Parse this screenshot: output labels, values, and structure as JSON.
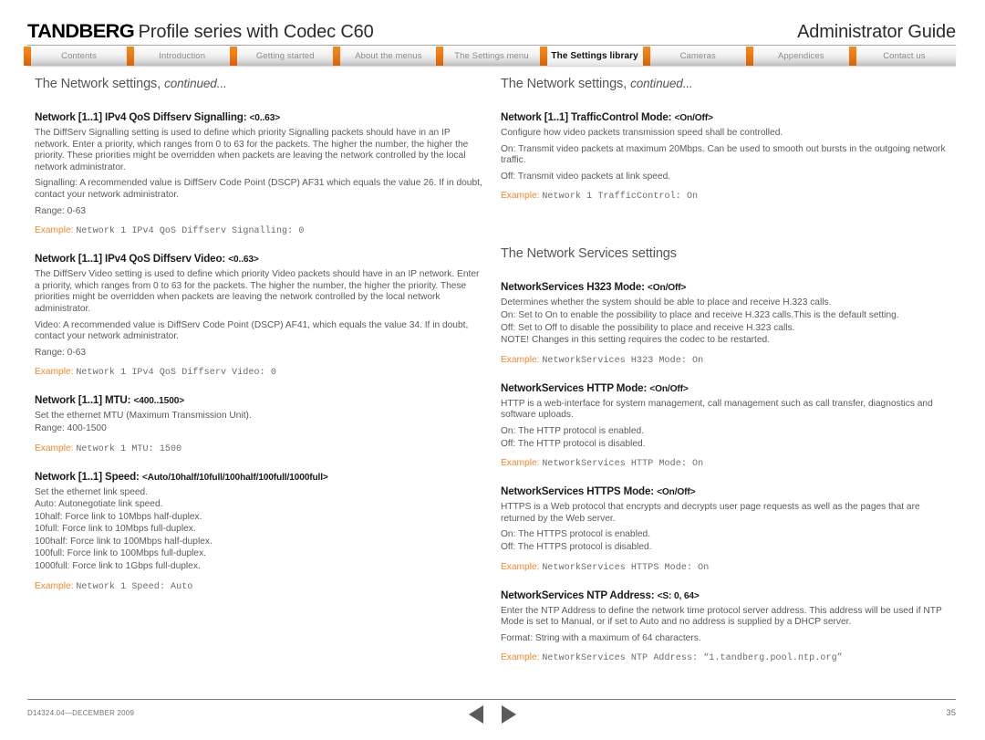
{
  "header": {
    "brand": "TANDBERG",
    "product": "Profile series with Codec C60",
    "guide_title": "Administrator Guide",
    "accent_color": "#ee7a10"
  },
  "tabs": [
    {
      "label": "Contents",
      "active": false
    },
    {
      "label": "Introduction",
      "active": false
    },
    {
      "label": "Getting started",
      "active": false
    },
    {
      "label": "About the menus",
      "active": false
    },
    {
      "label": "The Settings menu",
      "active": false
    },
    {
      "label": "The Settings library",
      "active": true
    },
    {
      "label": "Cameras",
      "active": false
    },
    {
      "label": "Appendices",
      "active": false
    },
    {
      "label": "Contact us",
      "active": false
    }
  ],
  "left_column": {
    "section_title": "The Network settings,",
    "section_title_italic": "continued...",
    "entries": [
      {
        "title": "Network [1..1] IPv4 QoS Diffserv Signalling:",
        "range": "<0..63>",
        "paragraphs": [
          "The DiffServ Signalling setting is used to define which priority Signalling packets should have in an IP network. Enter a priority, which ranges from 0 to 63 for the packets. The higher the number, the higher the priority. These priorities might be overridden when packets are leaving the network controlled by the local network administrator.",
          "Signalling: A recommended value is DiffServ Code Point (DSCP) AF31 which equals the value 26. If in doubt, contact your network administrator.",
          "Range: 0-63"
        ],
        "example_label": "Example:",
        "example_code": "Network 1 IPv4 QoS Diffserv Signalling: 0"
      },
      {
        "title": "Network [1..1] IPv4 QoS Diffserv Video:",
        "range": "<0..63>",
        "paragraphs": [
          "The DiffServ Video setting is used to define which priority Video packets should have in an IP network. Enter a priority, which ranges from 0 to 63 for the packets. The higher the number, the higher the priority. These priorities might be overridden when packets are leaving the network controlled by the local network administrator.",
          "Video: A recommended value is DiffServ Code Point (DSCP) AF41, which equals the value 34. If in doubt, contact your network administrator.",
          "Range: 0-63"
        ],
        "example_label": "Example:",
        "example_code": "Network 1 IPv4 QoS Diffserv Video: 0"
      },
      {
        "title": "Network [1..1] MTU:",
        "range": "<400..1500>",
        "paragraphs": [
          "Set the ethernet MTU (Maximum Transmission Unit).",
          "Range: 400-1500"
        ],
        "example_label": "Example:",
        "example_code": "Network 1 MTU: 1500"
      },
      {
        "title": "Network [1..1] Speed:",
        "range": "<Auto/10half/10full/100half/100full/1000full>",
        "paragraphs": [
          "Set the ethernet link speed.",
          "Auto: Autonegotiate link speed.",
          "10half: Force link to 10Mbps half-duplex.",
          "10full: Force link to 10Mbps full-duplex.",
          "100half: Force link to 100Mbps half-duplex.",
          "100full: Force link to 100Mbps full-duplex.",
          "1000full: Force link to 1Gbps full-duplex."
        ],
        "example_label": "Example:",
        "example_code": "Network 1 Speed: Auto"
      }
    ]
  },
  "right_column": {
    "section_title": "The Network settings,",
    "section_title_italic": "continued...",
    "section_title_2": "The Network Services settings",
    "entries_top": [
      {
        "title": "Network [1..1] TrafficControl Mode:",
        "range": "<On/Off>",
        "paragraphs": [
          "Configure how video packets transmission speed shall be controlled.",
          "On: Transmit video packets at maximum 20Mbps. Can be used to smooth out bursts in the outgoing network traffic.",
          "Off: Transmit video packets at link speed."
        ],
        "example_label": "Example:",
        "example_code": "Network 1 TrafficControl: On"
      }
    ],
    "entries_services": [
      {
        "title": "NetworkServices H323 Mode:",
        "range": "<On/Off>",
        "paragraphs": [
          "Determines whether the system should be able to place and receive H.323 calls.",
          "On: Set to On to enable the possibility to place and receive H.323 calls.This is the default setting.",
          "Off: Set to Off to disable the possibility to place and receive H.323 calls.",
          "NOTE! Changes in this setting requires the codec to be restarted."
        ],
        "example_label": "Example:",
        "example_code": "NetworkServices H323 Mode: On"
      },
      {
        "title": "NetworkServices HTTP Mode:",
        "range": "<On/Off>",
        "paragraphs": [
          "HTTP is a web-interface for system management, call management such as call transfer, diagnostics and software uploads.",
          "On: The HTTP protocol is enabled.",
          "Off: The HTTP protocol is disabled."
        ],
        "example_label": "Example:",
        "example_code": "NetworkServices HTTP Mode: On"
      },
      {
        "title": "NetworkServices HTTPS Mode:",
        "range": "<On/Off>",
        "paragraphs": [
          "HTTPS is a Web protocol that encrypts and decrypts user page requests as well as the pages that are returned by the Web server.",
          "On: The HTTPS protocol is enabled.",
          "Off: The HTTPS protocol is disabled."
        ],
        "example_label": "Example:",
        "example_code": "NetworkServices HTTPS Mode: On"
      },
      {
        "title": "NetworkServices NTP Address:",
        "range": "<S: 0, 64>",
        "paragraphs": [
          "Enter the NTP Address to define the network time protocol server address. This address will be used if NTP Mode is set to Manual, or if set to Auto and no address is supplied by a DHCP server.",
          "Format: String with a maximum of 64 characters."
        ],
        "example_label": "Example:",
        "example_code": "NetworkServices NTP Address: “1.tandberg.pool.ntp.org”"
      }
    ]
  },
  "footer": {
    "doc_id": "D14324.04—DECEMBER 2009",
    "page_number": "35",
    "prev_icon": "triangle-left-icon",
    "next_icon": "triangle-right-icon"
  }
}
